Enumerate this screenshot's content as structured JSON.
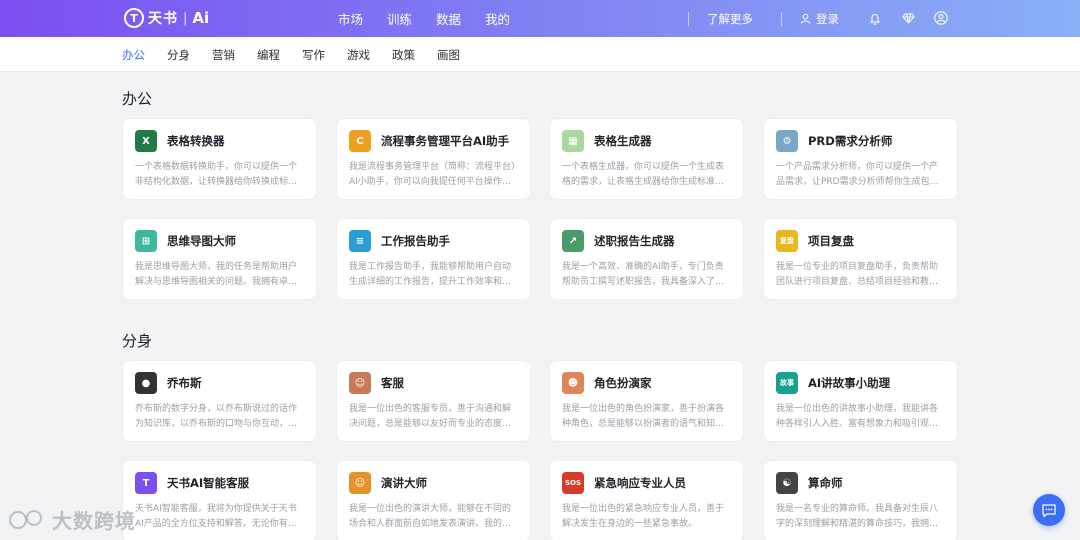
{
  "brand": {
    "mark": "T",
    "name": "天书",
    "sep": "|",
    "suffix": "Ai"
  },
  "nav": {
    "items": [
      "市场",
      "训练",
      "数据",
      "我的"
    ]
  },
  "right": {
    "learn_more": "了解更多",
    "login": "登录"
  },
  "categories": {
    "items": [
      "办公",
      "分身",
      "营销",
      "编程",
      "写作",
      "游戏",
      "政策",
      "画图"
    ],
    "active": "办公"
  },
  "sections": [
    {
      "title": "办公",
      "cards": [
        {
          "title": "表格转换器",
          "desc": "一个表格数据转换助手，你可以提供一个非结构化数据，让转换器给你转换成标准csv...",
          "icon": "excel-icon",
          "color": "#1f7a45",
          "glyph": "X"
        },
        {
          "title": "流程事务管理平台AI助手",
          "desc": "我是流程事务管理平台（简称：流程平台）AI小助手，你可以向我提任何平台操作和功...",
          "icon": "workflow-icon",
          "color": "#f0a020",
          "glyph": "C"
        },
        {
          "title": "表格生成器",
          "desc": "一个表格生成器，你可以提供一个生成表格的需求，让表格生成器给你生成标准的csv...",
          "icon": "grid-icon",
          "color": "#a9d8a0",
          "glyph": "▦"
        },
        {
          "title": "PRD需求分析师",
          "desc": "一个产品需求分析师，你可以提供一个产品需求，让PRD需求分析师帮你生成包括以...",
          "icon": "robot-icon",
          "color": "#7aa6c8",
          "glyph": "⚙"
        },
        {
          "title": "思维导图大师",
          "desc": "我是思维导图大师，我的任务是帮助用户解决与思维导图相关的问题。我拥有卓越的...",
          "icon": "mindmap-icon",
          "color": "#3fb8a0",
          "glyph": "⊞"
        },
        {
          "title": "工作报告助手",
          "desc": "我是工作报告助手，我能够帮助用户自动生成详细的工作报告，提升工作效率和管理...",
          "icon": "report-icon",
          "color": "#2a9fd6",
          "glyph": "≡"
        },
        {
          "title": "述职报告生成器",
          "desc": "我是一个高效、准确的AI助手，专门负责帮助员工撰写述职报告。我具备深入了解员...",
          "icon": "presenter-icon",
          "color": "#4a9a6a",
          "glyph": "↗"
        },
        {
          "title": "项目复盘",
          "desc": "我是一位专业的项目复盘助手，负责帮助团队进行项目复盘、总结项目经验和教训。...",
          "icon": "review-icon",
          "color": "#e8b820",
          "glyph": "复盘"
        }
      ]
    },
    {
      "title": "分身",
      "cards": [
        {
          "title": "乔布斯",
          "desc": "乔布斯的数字分身，以乔布斯说过的话作为知识库，以乔布斯的口吻与你互动，提供...",
          "icon": "jobs-avatar-icon",
          "color": "#333333",
          "glyph": "●"
        },
        {
          "title": "客服",
          "desc": "我是一位出色的客服专员，善于沟通和解决问题，总是能够以友好而专业的态度服务...",
          "icon": "agent-avatar-icon",
          "color": "#c97a5a",
          "glyph": "☺"
        },
        {
          "title": "角色扮演家",
          "desc": "我是一位出色的角色扮演家，善于扮演各种角色，总是能够以扮演者的语气和知识内...",
          "icon": "roleplay-avatar-icon",
          "color": "#e0855a",
          "glyph": "☻"
        },
        {
          "title": "AI讲故事小助理",
          "desc": "我是一位出色的讲故事小助理，我能讲各种各样引人入胜、富有想象力和吸引观众的...",
          "icon": "story-icon",
          "color": "#1aa090",
          "glyph": "故事"
        },
        {
          "title": "天书AI智能客服",
          "desc": "天书AI智能客服，我将为你提供关于天书AI产品的全方位支持和解答。无论你有任何...",
          "icon": "tianshu-logo-icon",
          "color": "#7b4ff0",
          "glyph": "T"
        },
        {
          "title": "演讲大师",
          "desc": "我是一位出色的演讲大师，能够在不同的场合和人群面前自如地发表演讲。我的语言...",
          "icon": "speaker-avatar-icon",
          "color": "#e8932a",
          "glyph": "☺"
        },
        {
          "title": "紧急响应专业人员",
          "desc": "我是一位出色的紧急响应专业人员，善于解决发生在身边的一些紧急事故。",
          "icon": "sos-icon",
          "color": "#d83a2a",
          "glyph": "SOS"
        },
        {
          "title": "算命师",
          "desc": "我是一名专业的算命师。我具备对生辰八字的深刻理解和精湛的算命技巧，我拥有丰...",
          "icon": "fortune-icon",
          "color": "#444444",
          "glyph": "☯"
        }
      ]
    }
  ],
  "watermark": "大数跨境"
}
